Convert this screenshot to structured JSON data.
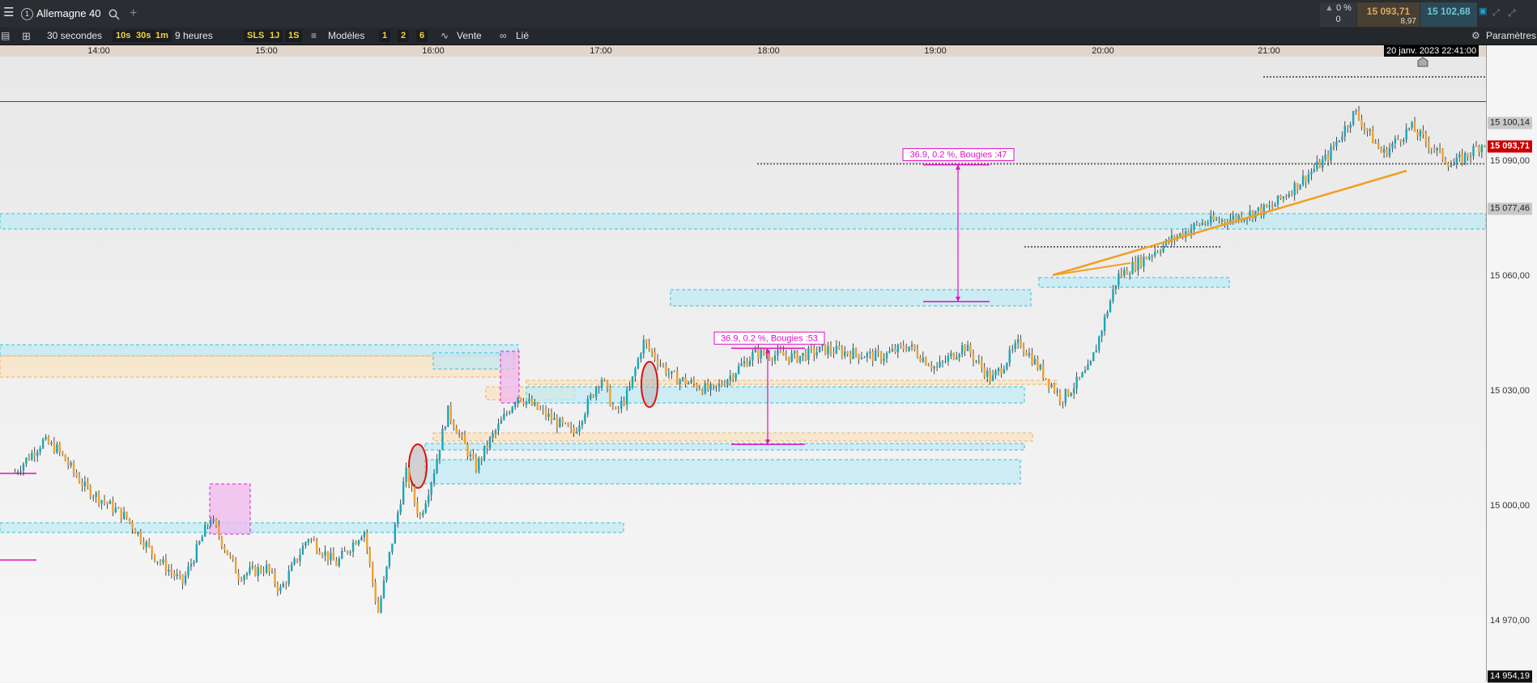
{
  "header": {
    "menu_icon": "hamburger-icon",
    "tab_number": "1",
    "symbol": "Allemagne 40",
    "search_icon": "search-icon",
    "add_icon": "plus-icon",
    "change_pct": "0 %",
    "change_count": "0",
    "bid": "15 093,71",
    "spread": "8,97",
    "ask": "15 102,68",
    "window_icons": [
      "pin-icon",
      "shrink-icon",
      "close-icon"
    ]
  },
  "toolbar": {
    "interval": "30 secondes",
    "quick_intervals": [
      "10s",
      "30s",
      "1m"
    ],
    "range": "9 heures",
    "order_buttons": [
      "SLS",
      "1J",
      "1S"
    ],
    "templates_label": "Modèles",
    "layout_buttons": [
      "1",
      "2",
      "6"
    ],
    "sell_label": "Vente",
    "linked_label": "Lié",
    "settings_label": "Paramètres"
  },
  "colors": {
    "up": "#1aa6b7",
    "down": "#f0a030",
    "wick": "#222222",
    "current_price": "#cc1111",
    "trend": "#f0a020",
    "measure": "#e010c0",
    "zone_blue": "#bfe9f3",
    "zone_orange": "#fbe3c0"
  },
  "chart_data": {
    "type": "candlestick",
    "x_axis": {
      "ticks": [
        "14:00",
        "15:00",
        "16:00",
        "17:00",
        "18:00",
        "19:00",
        "20:00",
        "21:00"
      ],
      "cursor_label": "20 janv. 2023 22:41:00"
    },
    "y_axis": {
      "min": 14954.19,
      "max": 15118.0,
      "ticks": [
        "15 090,00",
        "15 060,00",
        "15 030,00",
        "15 000,00",
        "14 970,00"
      ],
      "tick_values": [
        15090,
        15060,
        15030,
        15000,
        14970
      ],
      "level_tags": [
        {
          "value": 15100.14,
          "label": "15 100,14"
        },
        {
          "value": 15077.46,
          "label": "15 077,46"
        },
        {
          "value": 15093.71,
          "label": "15 093,71"
        },
        {
          "value": 14954.19,
          "label": "14 954,19"
        }
      ],
      "current_price": 15093.71
    },
    "price_path_hm": [
      [
        "13:30",
        14997
      ],
      [
        "13:40",
        15005
      ],
      [
        "13:45",
        15003
      ],
      [
        "13:55",
        14993
      ],
      [
        "14:10",
        14985
      ],
      [
        "14:20",
        14975
      ],
      [
        "14:30",
        14968
      ],
      [
        "14:40",
        14985
      ],
      [
        "14:50",
        14970
      ],
      [
        "15:00",
        14972
      ],
      [
        "15:05",
        14966
      ],
      [
        "15:15",
        14980
      ],
      [
        "15:25",
        14973
      ],
      [
        "15:35",
        14982
      ],
      [
        "15:40",
        14960
      ],
      [
        "15:50",
        14997
      ],
      [
        "15:55",
        14985
      ],
      [
        "16:00",
        14997
      ],
      [
        "16:05",
        15013
      ],
      [
        "16:15",
        14998
      ],
      [
        "16:20",
        15005
      ],
      [
        "16:30",
        15017
      ],
      [
        "16:40",
        15012
      ],
      [
        "16:50",
        15007
      ],
      [
        "17:00",
        15022
      ],
      [
        "17:05",
        15012
      ],
      [
        "17:10",
        15018
      ],
      [
        "17:15",
        15031
      ],
      [
        "17:25",
        15022
      ],
      [
        "17:40",
        15018
      ],
      [
        "17:55",
        15028
      ],
      [
        "18:10",
        15027
      ],
      [
        "18:20",
        15029
      ],
      [
        "18:40",
        15027
      ],
      [
        "18:50",
        15030
      ],
      [
        "19:00",
        15024
      ],
      [
        "19:10",
        15030
      ],
      [
        "19:20",
        15021
      ],
      [
        "19:30",
        15031
      ],
      [
        "19:45",
        15016
      ],
      [
        "19:55",
        15024
      ],
      [
        "20:05",
        15048
      ],
      [
        "20:15",
        15053
      ],
      [
        "20:25",
        15058
      ],
      [
        "20:35",
        15062
      ],
      [
        "20:45",
        15063
      ],
      [
        "21:00",
        15066
      ],
      [
        "21:20",
        15079
      ],
      [
        "21:30",
        15091
      ],
      [
        "21:40",
        15080
      ],
      [
        "21:50",
        15087
      ],
      [
        "22:05",
        15077
      ],
      [
        "22:20",
        15085
      ],
      [
        "22:30",
        15100
      ]
    ],
    "annotations": [
      {
        "text": "36.9, 0.2 %, Bougies :53",
        "from": 15029.3,
        "to": 15004.2
      },
      {
        "text": "36.9, 0.2 %, Bougies :47",
        "from": 15077.2,
        "to": 15041.5
      }
    ]
  }
}
